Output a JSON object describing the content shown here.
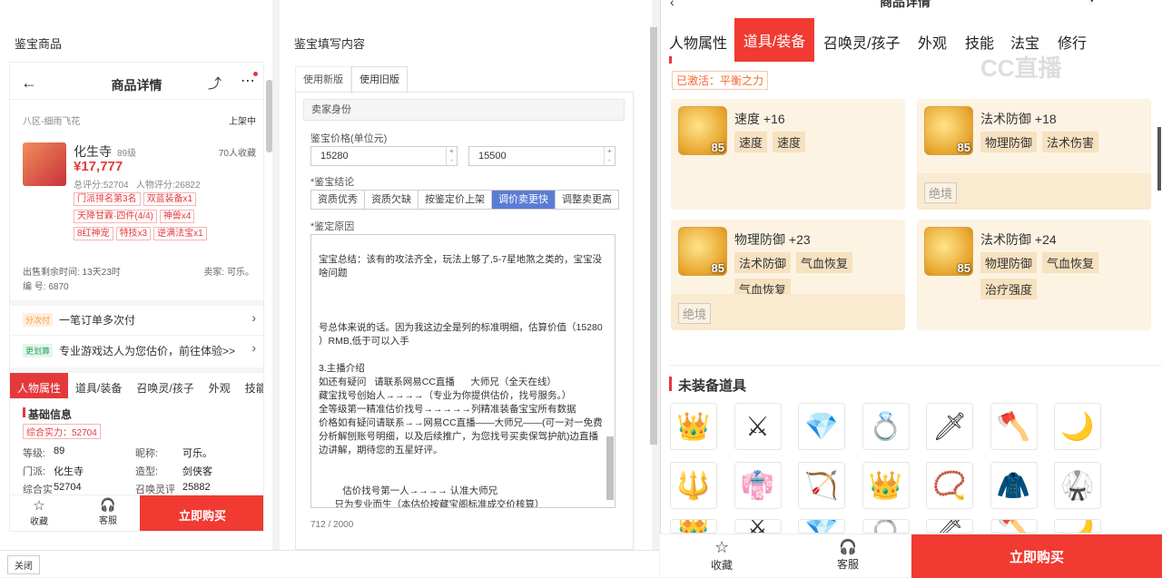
{
  "left_panel": {
    "title": "鉴宝商品"
  },
  "phone": {
    "header_title": "商品详情",
    "server": "八区-细雨飞花",
    "status": "上架中",
    "char_name": "化生寺",
    "char_level": "89级",
    "favorites": "70人收藏",
    "price": "¥17,777",
    "scores": "总评分:52704   人物评分:26822",
    "tags": [
      "门派排名第3名",
      "双蓝装备x1",
      "天降甘霖·四件(4/4)",
      "神兽x4",
      "8红神宠",
      "特技x3",
      "逆满法宝x1"
    ],
    "remaining_time": "出售剩余时间: 13天23时",
    "seller": "卖家: 可乐。",
    "serial": "编 号: 6870",
    "installment_badge": "分次付",
    "installment_text": "一笔订单多次付",
    "estimate_badge": "更划算",
    "estimate_text": "专业游戏达人为您估价，前往体验>>",
    "tabs": [
      "人物属性",
      "道具/装备",
      "召唤灵/孩子",
      "外观",
      "技能"
    ],
    "section_title": "基础信息",
    "combined_strength": "综合实力：52704",
    "attr": [
      [
        "等级:",
        "89",
        "昵称:",
        "可乐。"
      ],
      [
        "门派:",
        "化生寺",
        "造型:",
        "剑侠客"
      ],
      [
        "综合实力:",
        "52704",
        "召唤灵评分:",
        "25882"
      ]
    ],
    "bottom": {
      "fav": "收藏",
      "service": "客服",
      "buy": "立即购买"
    }
  },
  "form": {
    "title": "鉴宝填写内容",
    "version_tabs": [
      "使用新版",
      "使用旧版"
    ],
    "seller_identity": "卖家身份",
    "price_label": "鉴宝价格(单位元)",
    "price_min": "15280",
    "price_max": "15500",
    "conclusion_label": "*鉴宝结论",
    "conclusion_options": [
      "资质优秀",
      "资质欠缺",
      "按鉴定价上架",
      "调价卖更快",
      "调整卖更高"
    ],
    "reason_label": "*鉴定原因",
    "reason_lines": [
      "宝宝总结：该有的攻法齐全，玩法上够了,5-7星地煞之类的，宝宝没",
      "啥问题",
      "",
      "",
      "",
      "号总体来说的话。因为我这边全是列的标准明细，估算价值（15280",
      "）RMB,低于可以入手",
      "",
      "3.主播介绍",
      "如还有疑问   请联系网易CC直播      大师兄（全天在线）",
      "藏宝找号创始人→→→→（专业为你提供估价，找号服务。）",
      "全等级第一精准估价找号→→→→→列精准装备宝宝所有数据",
      "价格如有疑问请联系→→网易CC直播——大师兄——(可一对一免费",
      "分析解刨账号明细，以及后续推广，为您找号买卖保驾护航)边直播",
      "边讲解，期待您的五星好评。",
      "",
      "",
      "         估价找号第一人→→→→ 认准大师兄",
      "      只为专业而生（本估价按藏宝阁标准成交价核算）"
    ],
    "char_count": "712 / 2000",
    "close_btn": "关闭"
  },
  "right": {
    "header_title": "商品详情",
    "tabs": [
      "人物属性",
      "道具/装备",
      "召唤灵/孩子",
      "外观",
      "技能",
      "法宝",
      "修行"
    ],
    "watermark": "CC直播",
    "activated": "已激活：平衡之力",
    "cards": [
      {
        "title": "速度 +16",
        "chips": [
          "速度",
          "速度"
        ],
        "level": "85",
        "foot": ""
      },
      {
        "title": "法术防御 +18",
        "chips": [
          "物理防御",
          "法术伤害"
        ],
        "level": "85",
        "foot": "绝境"
      },
      {
        "title": "物理防御 +23",
        "chips": [
          "法术防御",
          "气血恢复",
          "气血恢复"
        ],
        "level": "85",
        "foot": "绝境"
      },
      {
        "title": "法术防御 +24",
        "chips": [
          "物理防御",
          "气血恢复",
          "治疗强度"
        ],
        "level": "85",
        "foot": ""
      }
    ],
    "unequipped_title": "未装备道具",
    "items_row1": [
      "👑",
      "⚔",
      "💎",
      "💍",
      "🗡",
      "🪓",
      "🌙"
    ],
    "items_row2": [
      "🔱",
      "👘",
      "🏹",
      "👑",
      "📿",
      "🧥",
      "🥋"
    ],
    "bottom": {
      "fav": "收藏",
      "service": "客服",
      "buy": "立即购买"
    }
  }
}
